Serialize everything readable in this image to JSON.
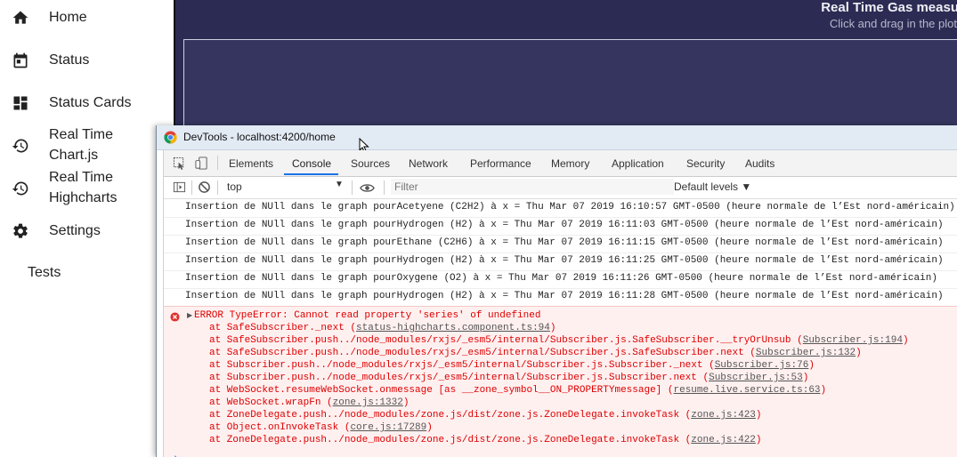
{
  "sidebar": {
    "items": [
      {
        "label": "Home",
        "icon": "home-icon"
      },
      {
        "label": "Status",
        "icon": "calendar-icon"
      },
      {
        "label": "Status Cards",
        "icon": "dashboard-icon"
      },
      {
        "label_line1": "Real Time",
        "label_line2": "Chart.js",
        "icon": "history-icon"
      },
      {
        "label_line1": "Real Time",
        "label_line2": "Highcharts",
        "icon": "history-icon"
      },
      {
        "label": "Settings",
        "icon": "gear-icon"
      }
    ],
    "tests_label": "Tests"
  },
  "main": {
    "chart_title": "Real Time Gas measu",
    "chart_subtitle": "Click and drag in the plot"
  },
  "devtools": {
    "window_title": "DevTools - localhost:4200/home",
    "tabs": [
      "Elements",
      "Console",
      "Sources",
      "Network",
      "Performance",
      "Memory",
      "Application",
      "Security",
      "Audits"
    ],
    "active_tab": "Console",
    "context": "top",
    "filter_placeholder": "Filter",
    "levels_label": "Default levels ▼",
    "logs": [
      "Insertion de NUll dans le graph pourAcetyene (C2H2) à x = Thu Mar 07 2019 16:10:57 GMT-0500 (heure normale de l’Est nord-américain)",
      "Insertion de NUll dans le graph pourHydrogen (H2) à x = Thu Mar 07 2019 16:11:03 GMT-0500 (heure normale de l’Est nord-américain)",
      "Insertion de NUll dans le graph pourEthane (C2H6) à x = Thu Mar 07 2019 16:11:15 GMT-0500 (heure normale de l’Est nord-américain)",
      "Insertion de NUll dans le graph pourHydrogen (H2) à x = Thu Mar 07 2019 16:11:25 GMT-0500 (heure normale de l’Est nord-américain)",
      "Insertion de NUll dans le graph pourOxygene (O2) à x = Thu Mar 07 2019 16:11:26 GMT-0500 (heure normale de l’Est nord-américain)",
      "Insertion de NUll dans le graph pourHydrogen (H2) à x = Thu Mar 07 2019 16:11:28 GMT-0500 (heure normale de l’Est nord-américain)"
    ],
    "error": {
      "header": "ERROR TypeError: Cannot read property 'series' of undefined",
      "stack": [
        {
          "text": "at SafeSubscriber._next (",
          "link": "status-highcharts.component.ts:94",
          "end": ")"
        },
        {
          "text": "at SafeSubscriber.push../node_modules/rxjs/_esm5/internal/Subscriber.js.SafeSubscriber.__tryOrUnsub (",
          "link": "Subscriber.js:194",
          "end": ")"
        },
        {
          "text": "at SafeSubscriber.push../node_modules/rxjs/_esm5/internal/Subscriber.js.SafeSubscriber.next (",
          "link": "Subscriber.js:132",
          "end": ")"
        },
        {
          "text": "at Subscriber.push../node_modules/rxjs/_esm5/internal/Subscriber.js.Subscriber._next (",
          "link": "Subscriber.js:76",
          "end": ")"
        },
        {
          "text": "at Subscriber.push../node_modules/rxjs/_esm5/internal/Subscriber.js.Subscriber.next (",
          "link": "Subscriber.js:53",
          "end": ")"
        },
        {
          "text": "at WebSocket.resumeWebSocket.onmessage [as __zone_symbol__ON_PROPERTYmessage] (",
          "link": "resume.live.service.ts:63",
          "end": ")"
        },
        {
          "text": "at WebSocket.wrapFn (",
          "link": "zone.js:1332",
          "end": ")"
        },
        {
          "text": "at ZoneDelegate.push../node_modules/zone.js/dist/zone.js.ZoneDelegate.invokeTask (",
          "link": "zone.js:423",
          "end": ")"
        },
        {
          "text": "at Object.onInvokeTask (",
          "link": "core.js:17289",
          "end": ")"
        },
        {
          "text": "at ZoneDelegate.push../node_modules/zone.js/dist/zone.js.ZoneDelegate.invokeTask (",
          "link": "zone.js:422",
          "end": ")"
        }
      ]
    },
    "prompt_symbol": "›"
  }
}
